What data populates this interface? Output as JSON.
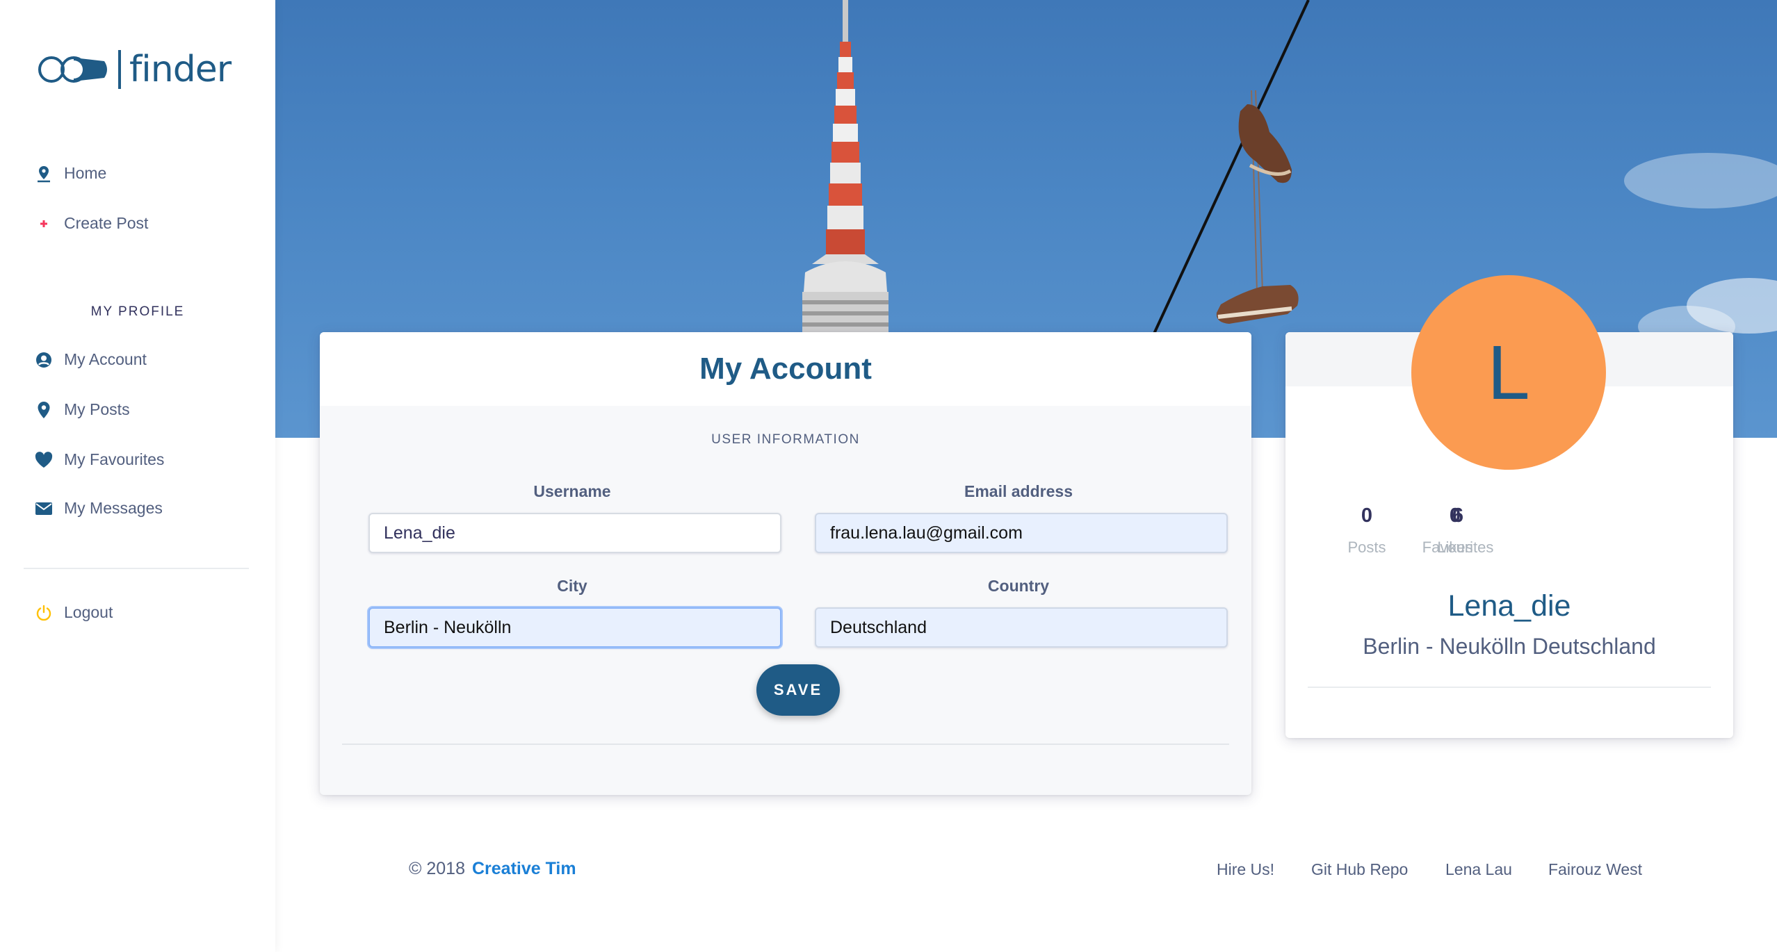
{
  "sidebar": {
    "logo_text": "finder",
    "items": [
      {
        "label": "Home",
        "icon": "map-pin-icon"
      },
      {
        "label": "Create Post",
        "icon": "plus-icon"
      }
    ],
    "profile_heading": "MY PROFILE",
    "profile_items": [
      {
        "label": "My Account",
        "icon": "user-circle-icon"
      },
      {
        "label": "My Posts",
        "icon": "location-pin-icon"
      },
      {
        "label": "My Favourites",
        "icon": "heart-icon"
      },
      {
        "label": "My Messages",
        "icon": "envelope-icon"
      }
    ],
    "logout_label": "Logout",
    "logout_icon": "power-icon"
  },
  "colors": {
    "brand": "#1f5b86",
    "accent_orange": "#fb9b51",
    "plus_red": "#f5365c",
    "logout_yellow": "#ffc107",
    "link_blue": "#1a7fd6"
  },
  "account_card": {
    "title": "My Account",
    "section_label": "USER INFORMATION",
    "fields": {
      "username": {
        "label": "Username",
        "value": "Lena_die"
      },
      "email": {
        "label": "Email address",
        "value": "frau.lena.lau@gmail.com"
      },
      "city": {
        "label": "City",
        "value": "Berlin - Neukölln"
      },
      "country": {
        "label": "Country",
        "value": "Deutschland"
      }
    },
    "save_label": "SAVE"
  },
  "profile_card": {
    "avatar_initial": "L",
    "stats": [
      {
        "value": "0",
        "label": "Posts"
      },
      {
        "value": "0",
        "label": "Likes"
      },
      {
        "value": "6",
        "label": "Favourites"
      }
    ],
    "name": "Lena_die",
    "location": "Berlin - Neukölln Deutschland"
  },
  "footer": {
    "copyright": "© 2018",
    "brand": "Creative Tim",
    "links": [
      "Hire Us!",
      "Git Hub Repo",
      "Lena Lau",
      "Fairouz West"
    ]
  }
}
